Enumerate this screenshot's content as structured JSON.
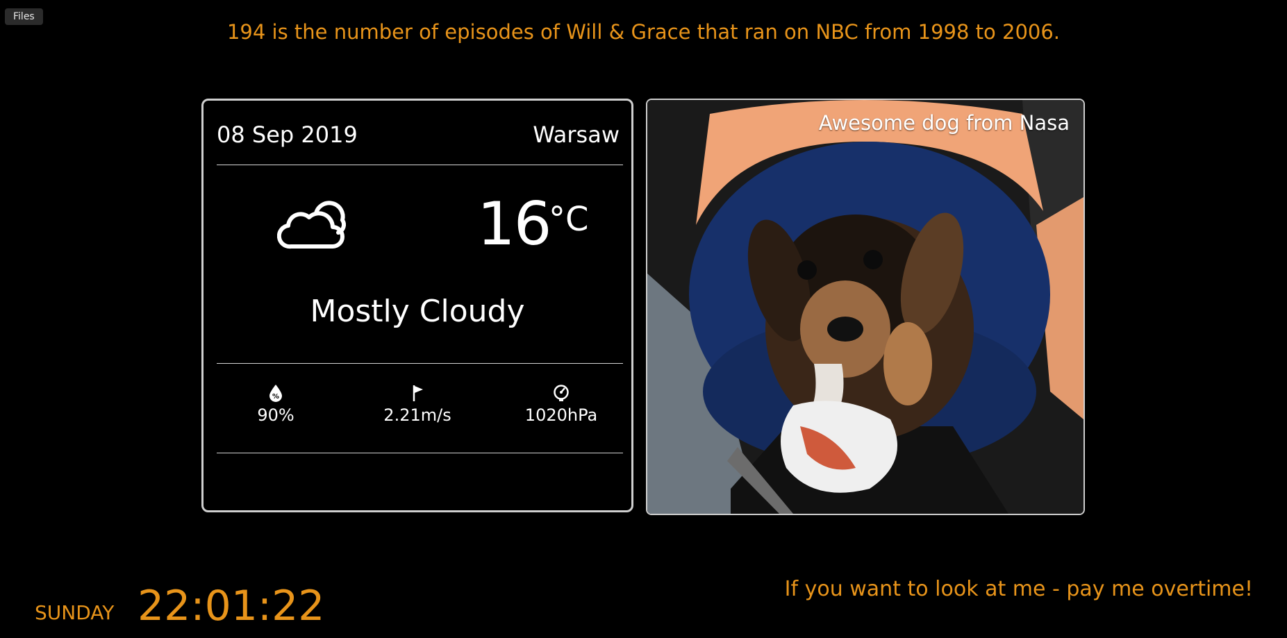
{
  "toolbar": {
    "files_label": "Files"
  },
  "fact": {
    "text": "194 is the number of episodes of Will & Grace that ran on NBC from 1998 to 2006."
  },
  "weather": {
    "date": "08 Sep 2019",
    "city": "Warsaw",
    "icon": "cloud-icon",
    "temperature": "16",
    "unit": "°C",
    "condition": "Mostly Cloudy",
    "stats": [
      {
        "icon": "humidity-icon",
        "value": "90%"
      },
      {
        "icon": "wind-flag-icon",
        "value": "2.21m/s"
      },
      {
        "icon": "pressure-gauge-icon",
        "value": "1020hPa"
      }
    ]
  },
  "photo": {
    "caption": "Awesome dog from Nasa"
  },
  "footer": {
    "day": "SUNDAY",
    "time": "22:01:22",
    "message": "If you want to look at me - pay me overtime!"
  },
  "colors": {
    "accent": "#e8941a",
    "background": "#000000",
    "card_border": "#cfcfcf"
  }
}
